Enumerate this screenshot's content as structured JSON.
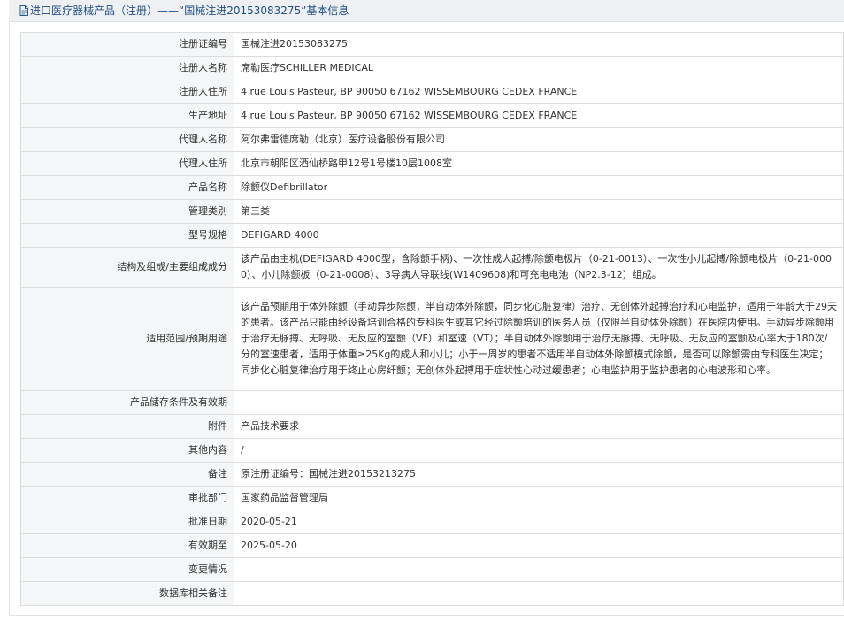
{
  "header": {
    "title": "进口医疗器械产品（注册）——“国械注进20153083275”基本信息",
    "icon": "document-icon"
  },
  "record": {
    "rows": [
      {
        "label": "注册证编号",
        "value": "国械注进20153083275"
      },
      {
        "label": "注册人名称",
        "value": "席勒医疗SCHILLER MEDICAL"
      },
      {
        "label": "注册人住所",
        "value": "4 rue Louis Pasteur, BP 90050 67162 WISSEMBOURG CEDEX FRANCE"
      },
      {
        "label": "生产地址",
        "value": "4 rue Louis Pasteur, BP 90050 67162 WISSEMBOURG CEDEX FRANCE"
      },
      {
        "label": "代理人名称",
        "value": "阿尔弗雷德席勒（北京）医疗设备股份有限公司"
      },
      {
        "label": "代理人住所",
        "value": "北京市朝阳区酒仙桥路甲12号1号楼10层1008室"
      },
      {
        "label": "产品名称",
        "value": "除颤仪Defibrillator"
      },
      {
        "label": "管理类别",
        "value": "第三类"
      },
      {
        "label": "型号规格",
        "value": "DEFIGARD 4000"
      },
      {
        "label": "结构及组成/主要组成成分",
        "value": "该产品由主机(DEFIGARD 4000型，含除颤手柄)、一次性成人起搏/除颤电极片（0-21-0013）、一次性小儿起搏/除颤电极片（0-21-0000）、小儿除颤板（0-21-0008）、3导病人导联线(W1409608)和可充电电池（NP2.3-12）组成。"
      },
      {
        "label": "适用范围/预期用途",
        "value": "该产品预期用于体外除颤（手动异步除颤，半自动体外除颤，同步化心脏复律）治疗、无创体外起搏治疗和心电监护，适用于年龄大于29天的患者。该产品只能由经设备培训合格的专科医生或其它经过除颤培训的医务人员（仅限半自动体外除颤）在医院内使用。手动异步除颤用于治疗无脉搏、无呼吸、无反应的室颤（VF）和室速（VT）；半自动体外除颤用于治疗无脉搏、无呼吸、无反应的室颤及心率大于180次/分的室速患者，适用于体重≥25Kg的成人和小儿；小于一周岁的患者不适用半自动体外除颤模式除颤，是否可以除颤需由专科医生决定；同步化心脏复律治疗用于终止心房纤颤；无创体外起搏用于症状性心动过缓患者；心电监护用于监护患者的心电波形和心率。"
      },
      {
        "label": "产品储存条件及有效期",
        "value": ""
      },
      {
        "label": "附件",
        "value": "产品技术要求"
      },
      {
        "label": "其他内容",
        "value": "/"
      },
      {
        "label": "备注",
        "value": "原注册证编号：国械注进20153213275"
      },
      {
        "label": "审批部门",
        "value": "国家药品监督管理局"
      },
      {
        "label": "批准日期",
        "value": "2020-05-21"
      },
      {
        "label": "有效期至",
        "value": "2025-05-20"
      },
      {
        "label": "变更情况",
        "value": ""
      },
      {
        "label": "数据库相关备注",
        "value": ""
      }
    ]
  }
}
